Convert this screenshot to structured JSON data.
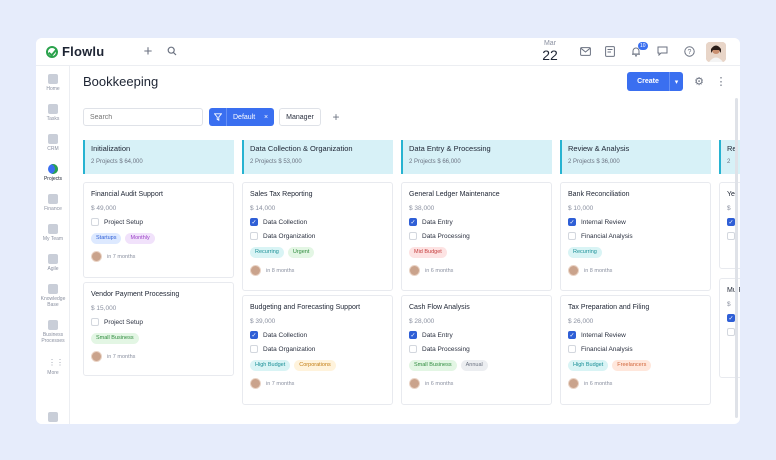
{
  "topbar": {
    "logo": "Flowlu",
    "date_month": "Mar",
    "date_day": "22",
    "notification_count": "10"
  },
  "sidebar": {
    "items": [
      {
        "label": "Home"
      },
      {
        "label": "Tasks"
      },
      {
        "label": "CRM"
      },
      {
        "label": "Projects"
      },
      {
        "label": "Finance"
      },
      {
        "label": "My Team"
      },
      {
        "label": "Agile"
      },
      {
        "label": "Knowledge Base"
      },
      {
        "label": "Business Processes"
      },
      {
        "label": "More"
      }
    ]
  },
  "header": {
    "title": "Bookkeeping",
    "create_label": "Create"
  },
  "filters": {
    "search_placeholder": "Search",
    "filter_label": "Default",
    "filter_clear": "×",
    "manager_label": "Manager"
  },
  "columns": [
    {
      "title": "Initialization",
      "summary": "2 Projects  $ 64,000",
      "cards": [
        {
          "title": "Financial Audit Support",
          "amount": "$ 49,000",
          "tasks": [
            {
              "label": "Project Setup",
              "checked": false
            }
          ],
          "tags": [
            {
              "label": "Startups",
              "color": "blue"
            },
            {
              "label": "Monthly",
              "color": "purple"
            }
          ],
          "due": "in 7 months"
        },
        {
          "title": "Vendor Payment Processing",
          "amount": "$ 15,000",
          "tasks": [
            {
              "label": "Project Setup",
              "checked": false
            }
          ],
          "tags": [
            {
              "label": "Small Business",
              "color": "green"
            }
          ],
          "due": "in 7 months"
        }
      ]
    },
    {
      "title": "Data Collection & Organization",
      "summary": "2 Projects  $ 53,000",
      "cards": [
        {
          "title": "Sales Tax Reporting",
          "amount": "$ 14,000",
          "tasks": [
            {
              "label": "Data Collection",
              "checked": true
            },
            {
              "label": "Data Organization",
              "checked": false
            }
          ],
          "tags": [
            {
              "label": "Recurring",
              "color": "teal"
            },
            {
              "label": "Urgent",
              "color": "green"
            }
          ],
          "due": "in 8 months"
        },
        {
          "title": "Budgeting and Forecasting Support",
          "amount": "$ 39,000",
          "tasks": [
            {
              "label": "Data Collection",
              "checked": true
            },
            {
              "label": "Data Organization",
              "checked": false
            }
          ],
          "tags": [
            {
              "label": "High Budget",
              "color": "teal"
            },
            {
              "label": "Corporations",
              "color": "orange"
            }
          ],
          "due": "in 7 months"
        }
      ]
    },
    {
      "title": "Data Entry & Processing",
      "summary": "2 Projects  $ 66,000",
      "cards": [
        {
          "title": "General Ledger Maintenance",
          "amount": "$ 38,000",
          "tasks": [
            {
              "label": "Data Entry",
              "checked": true
            },
            {
              "label": "Data Processing",
              "checked": false
            }
          ],
          "tags": [
            {
              "label": "Mid Budget",
              "color": "red"
            }
          ],
          "due": "in 6 months"
        },
        {
          "title": "Cash Flow Analysis",
          "amount": "$ 28,000",
          "tasks": [
            {
              "label": "Data Entry",
              "checked": true
            },
            {
              "label": "Data Processing",
              "checked": false
            }
          ],
          "tags": [
            {
              "label": "Small Business",
              "color": "green"
            },
            {
              "label": "Annual",
              "color": "gray"
            }
          ],
          "due": "in 6 months"
        }
      ]
    },
    {
      "title": "Review & Analysis",
      "summary": "2 Projects  $ 36,000",
      "cards": [
        {
          "title": "Bank Reconciliation",
          "amount": "$ 10,000",
          "tasks": [
            {
              "label": "Internal Review",
              "checked": true
            },
            {
              "label": "Financial Analysis",
              "checked": false
            }
          ],
          "tags": [
            {
              "label": "Recurring",
              "color": "teal"
            }
          ],
          "due": "in 8 months"
        },
        {
          "title": "Tax Preparation and Filing",
          "amount": "$ 26,000",
          "tasks": [
            {
              "label": "Internal Review",
              "checked": true
            },
            {
              "label": "Financial Analysis",
              "checked": false
            }
          ],
          "tags": [
            {
              "label": "High Budget",
              "color": "teal"
            },
            {
              "label": "Freelancers",
              "color": "salmon"
            }
          ],
          "due": "in 6 months"
        }
      ]
    },
    {
      "title": "Re",
      "summary": "2",
      "cards": [
        {
          "title": "Ye",
          "amount": "$",
          "tasks": [
            {
              "label": "",
              "checked": true
            },
            {
              "label": "",
              "checked": false
            }
          ],
          "tags": [],
          "due": ""
        },
        {
          "title": "Mu Pro",
          "amount": "$",
          "tasks": [
            {
              "label": "",
              "checked": true
            },
            {
              "label": "",
              "checked": false
            }
          ],
          "tags": [],
          "due": ""
        }
      ]
    }
  ]
}
